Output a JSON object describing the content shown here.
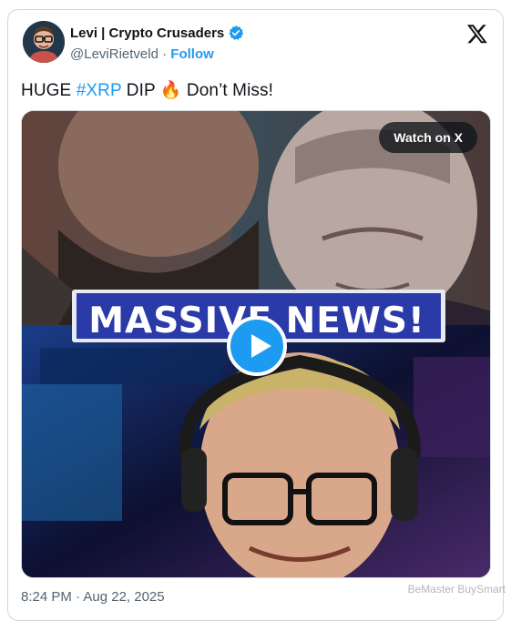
{
  "author": {
    "display_name": "Levi | Crypto Crusaders",
    "handle": "@LeviRietveld",
    "follow_label": "Follow",
    "separator": "·"
  },
  "tweet": {
    "text_before": "HUGE ",
    "hashtag": "#XRP",
    "text_middle": " DIP ",
    "emoji": "🔥",
    "text_after": " Don’t Miss!"
  },
  "media": {
    "watch_label": "Watch on X",
    "headline": "MASSIVE NEWS!"
  },
  "timestamp": "8:24 PM · Aug 22, 2025",
  "watermark": "BeMaster BuySmart",
  "colors": {
    "accent": "#1d9bf0",
    "text": "#0f1419",
    "secondary": "#536471",
    "border": "#cfd9de"
  }
}
